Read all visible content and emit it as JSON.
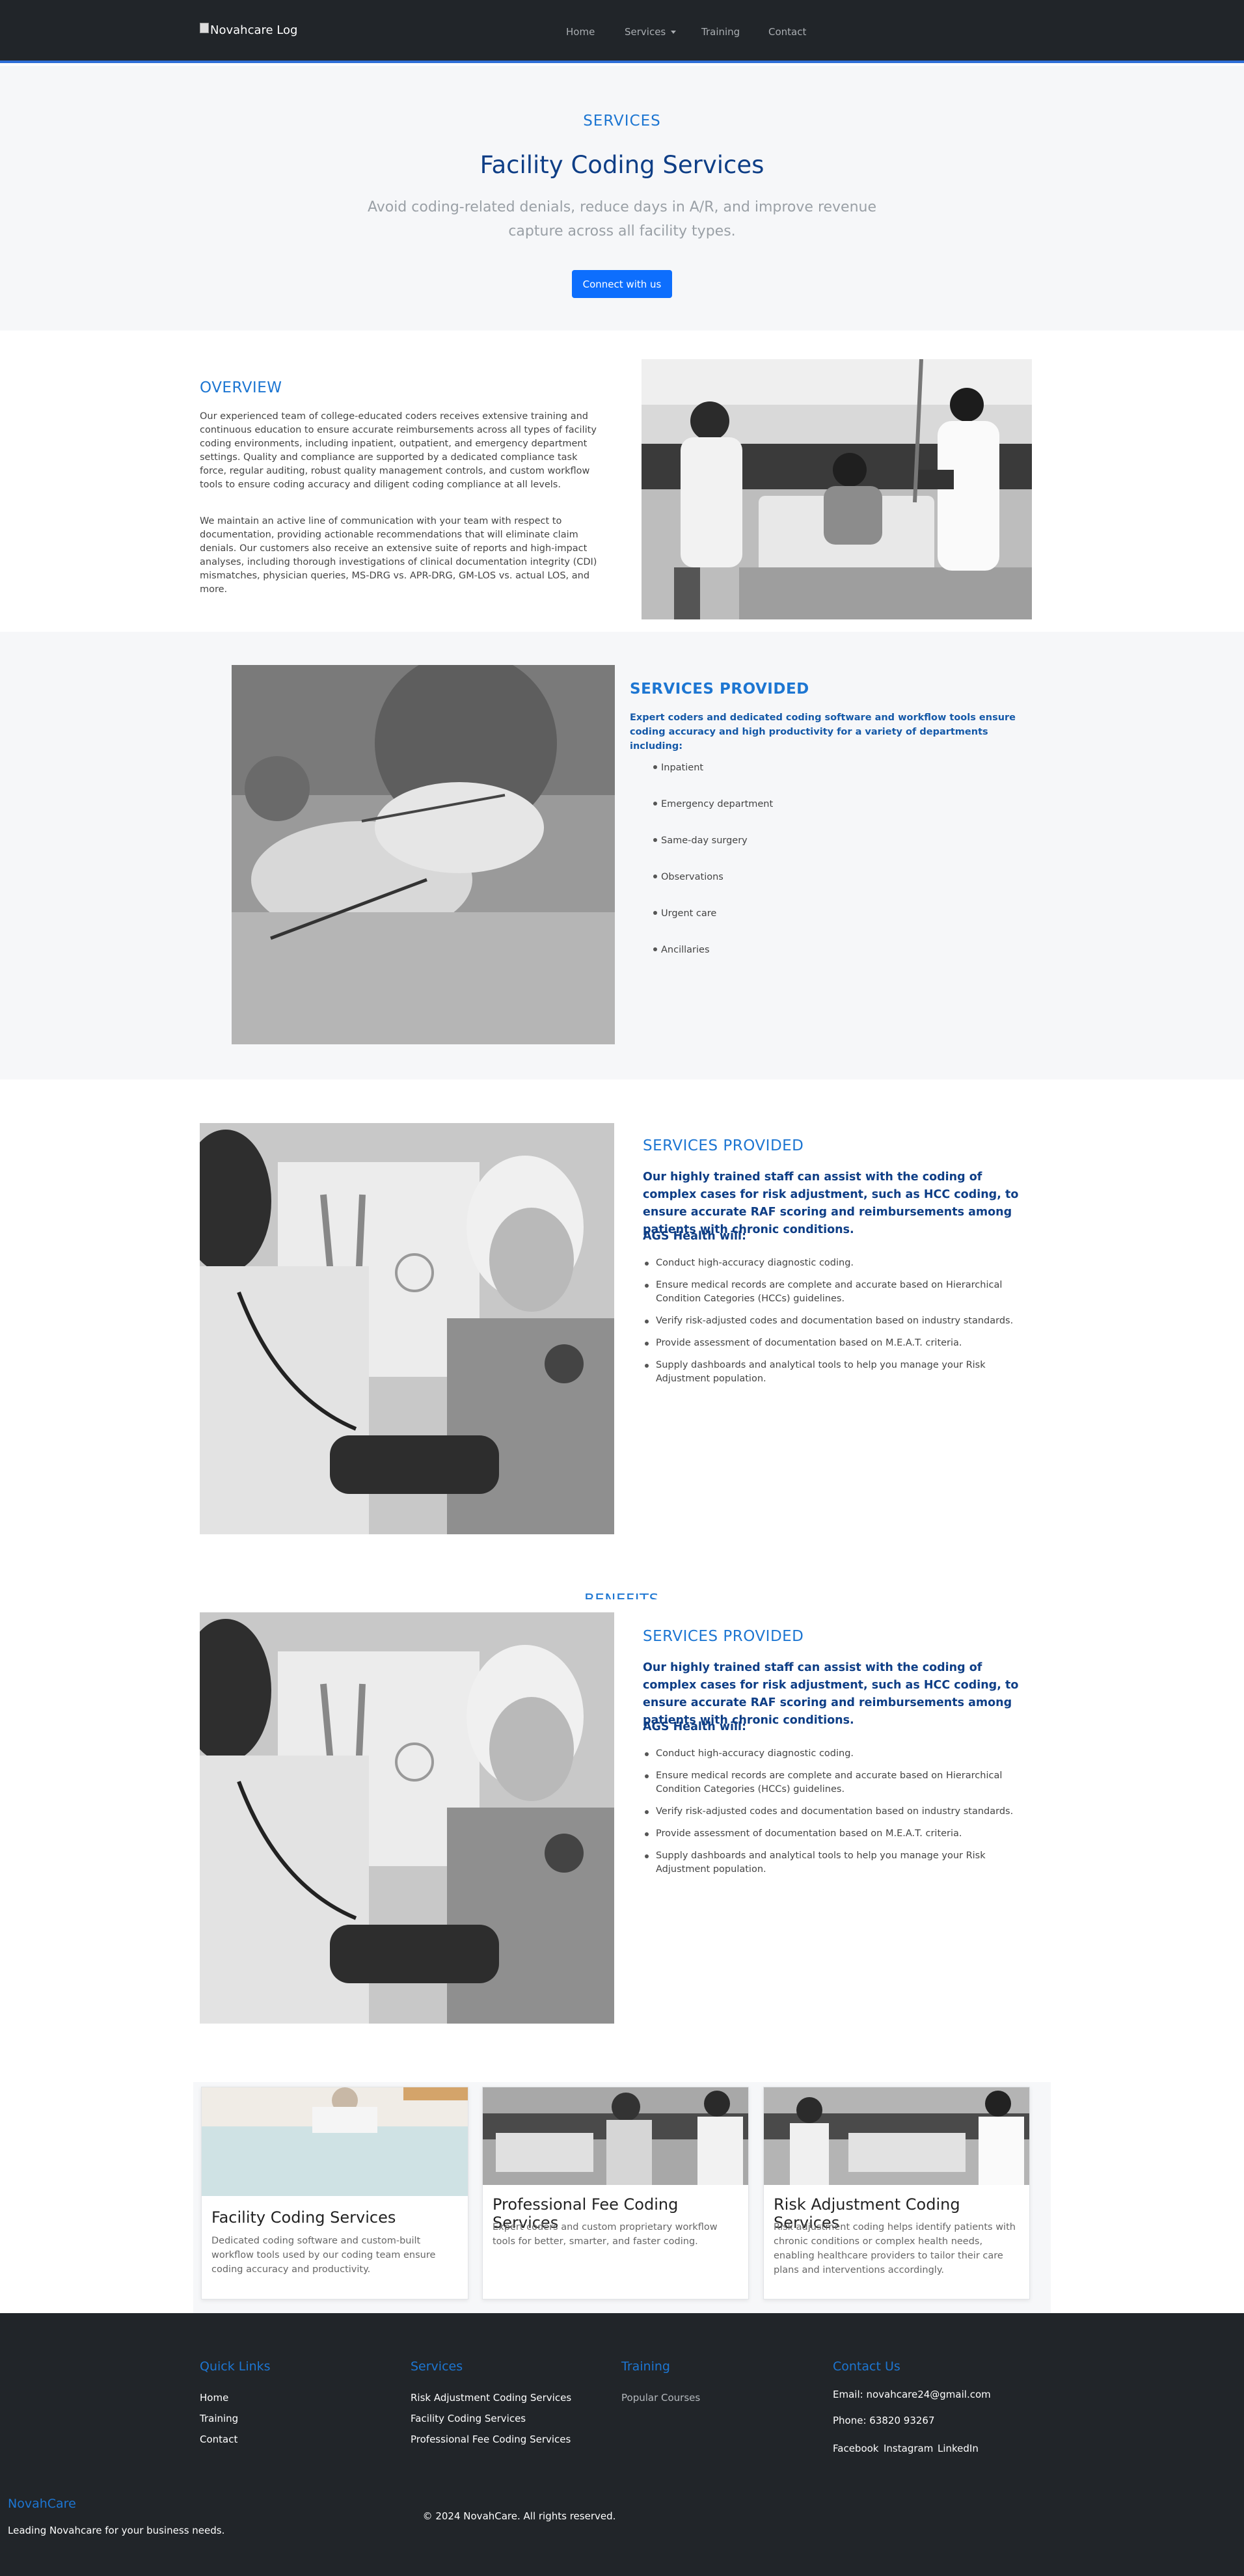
{
  "nav": {
    "logo_alt": "Novahcare Log",
    "items": [
      {
        "label": "Home"
      },
      {
        "label": "Services"
      },
      {
        "label": "Training"
      },
      {
        "label": "Contact"
      }
    ]
  },
  "hero": {
    "eyebrow": "SERVICES",
    "title": "Facility Coding Services",
    "subtitle": "Avoid coding-related denials, reduce days in A/R, and improve revenue capture across all facility types.",
    "button": "Connect with us"
  },
  "overview": {
    "heading": "OVERVIEW",
    "p1": "Our experienced team of college-educated coders receives extensive training and continuous education to ensure accurate reimbursements across all types of facility coding environments, including inpatient, outpatient, and emergency department settings. Quality and compliance are supported by a dedicated compliance task force, regular auditing, robust quality management controls, and custom workflow tools to ensure coding accuracy and diligent coding compliance at all levels.",
    "p2": "We maintain an active line of communication with your team with respect to documentation, providing actionable recommendations that will eliminate claim denials. Our customers also receive an extensive suite of reports and high-impact analyses, including thorough investigations of clinical documentation integrity (CDI) mismatches, physician queries, MS-DRG vs. APR-DRG, GM-LOS vs. actual LOS, and more."
  },
  "services1": {
    "heading": "SERVICES PROVIDED",
    "lead": "Expert coders and dedicated coding software and workflow tools ensure coding accuracy and high productivity for a variety of departments including:",
    "items": [
      "Inpatient",
      "Emergency department",
      "Same-day surgery",
      "Observations",
      "Urgent care",
      "Ancillaries"
    ]
  },
  "services2": {
    "heading": "SERVICES PROVIDED",
    "lead": "Our highly trained staff can assist with the coding of complex cases for risk adjustment, such as HCC coding, to ensure accurate RAF scoring and reimbursements among patients with chronic conditions.",
    "subhead": "AGS Health will:",
    "items": [
      "Conduct high-accuracy diagnostic coding.",
      "Ensure medical records are complete and accurate based on Hierarchical Condition Categories (HCCs) guidelines.",
      "Verify risk-adjusted codes and documentation based on industry standards.",
      "Provide assessment of documentation based on M.E.A.T. criteria.",
      "Supply dashboards and analytical tools to help you manage your Risk Adjustment population."
    ]
  },
  "benefits_partial": "BENEFITS",
  "services3": {
    "heading": "SERVICES PROVIDED",
    "lead": "Our highly trained staff can assist with the coding of complex cases for risk adjustment, such as HCC coding, to ensure accurate RAF scoring and reimbursements among patients with chronic conditions.",
    "subhead": "AGS Health will:",
    "items": [
      "Conduct high-accuracy diagnostic coding.",
      "Ensure medical records are complete and accurate based on Hierarchical Condition Categories (HCCs) guidelines.",
      "Verify risk-adjusted codes and documentation based on industry standards.",
      "Provide assessment of documentation based on M.E.A.T. criteria.",
      "Supply dashboards and analytical tools to help you manage your Risk Adjustment population."
    ]
  },
  "cards": [
    {
      "title": "Facility Coding Services",
      "text": "Dedicated coding software and custom-built workflow tools used by our coding team ensure coding accuracy and productivity."
    },
    {
      "title": "Professional Fee Coding Services",
      "text": "Expert coders and custom proprietary workflow tools for better, smarter, and faster coding."
    },
    {
      "title": "Risk Adjustment Coding Services",
      "text": "Risk adjustment coding helps identify patients with chronic conditions or complex health needs, enabling healthcare providers to tailor their care plans and interventions accordingly."
    }
  ],
  "footer": {
    "quick_links": {
      "heading": "Quick Links",
      "items": [
        "Home",
        "Training",
        "Contact"
      ]
    },
    "services": {
      "heading": "Services",
      "items": [
        "Risk Adjustment Coding Services",
        "Facility Coding Services",
        "Professional Fee Coding Services"
      ]
    },
    "training": {
      "heading": "Training",
      "items": [
        "Popular Courses"
      ]
    },
    "contact": {
      "heading": "Contact Us",
      "email": "Email: novahcare24@gmail.com",
      "phone": "Phone: 63820 93267",
      "social": [
        "Facebook",
        "Instagram",
        "LinkedIn"
      ]
    },
    "brand": "NovahCare",
    "tagline": "Leading Novahcare for your business needs.",
    "copyright": "© 2024 NovahCare. All rights reserved."
  },
  "colors": {
    "nav_bg": "#212529",
    "accent": "#1d76d2",
    "navy": "#0e3e86",
    "button": "#0d6efd",
    "hero_bg": "#f6f7f9"
  }
}
